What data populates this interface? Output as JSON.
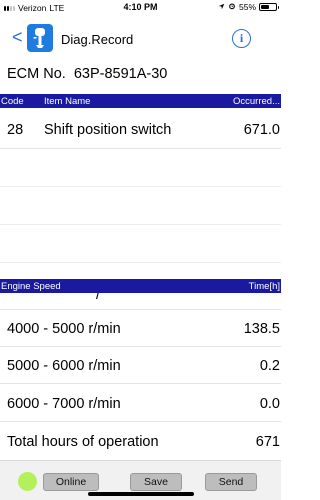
{
  "status_bar": {
    "carrier": "Verizon",
    "network": "LTE",
    "time": "4:10 PM",
    "battery": "55%",
    "icons": [
      "location-icon",
      "alarm-icon",
      "battery-icon"
    ]
  },
  "nav": {
    "back_label": "<",
    "title": "Diag.Record",
    "info_label": "i"
  },
  "ecm": {
    "label": "ECM No.",
    "value": "63P-8591A-30"
  },
  "code_table": {
    "headers": {
      "code": "Code",
      "item": "Item Name",
      "occurred": "Occurred..."
    },
    "rows": [
      {
        "code": "28",
        "item": "Shift position switch",
        "occurred": "671.0"
      }
    ]
  },
  "speed_table": {
    "headers": {
      "speed": "Engine Speed",
      "time": "Time[h]"
    },
    "partial_row_label": "/",
    "rows": [
      {
        "range": "4000  -  5000 r/min",
        "value": "138.5"
      },
      {
        "range": "5000  -  6000 r/min",
        "value": "0.2"
      },
      {
        "range": "6000  -  7000 r/min",
        "value": "0.0"
      },
      {
        "range": "Total hours of operation",
        "value": "671"
      }
    ]
  },
  "toolbar": {
    "status_color": "#b4f05a",
    "online_label": "Online",
    "save_label": "Save",
    "send_label": "Send"
  },
  "colors": {
    "header_bg": "#1a1aa0",
    "accent": "#2a6fe0"
  }
}
